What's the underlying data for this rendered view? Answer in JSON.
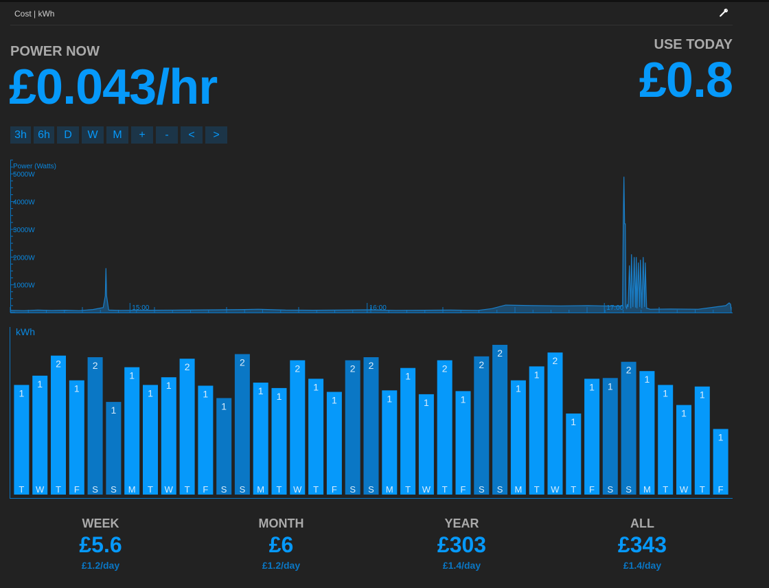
{
  "header": {
    "title": "Cost | kWh",
    "settings_icon": "wrench-icon"
  },
  "power_now": {
    "label": "POWER NOW",
    "value": "£0.043/hr"
  },
  "use_today": {
    "label": "USE TODAY",
    "value": "£0.8"
  },
  "range_buttons": [
    "3h",
    "6h",
    "D",
    "W",
    "M",
    "+",
    "-",
    "<",
    ">"
  ],
  "colors": {
    "background": "#222222",
    "accent": "#0699fa",
    "weekend_bar": "#0a77c5",
    "line": "#1a6dad",
    "button_bg": "#1c3548",
    "label_grey": "#aaaaaa"
  },
  "chart_data": [
    {
      "type": "area",
      "title": "",
      "ylabel": "Power (Watts)",
      "y_ticks": [
        "1000W",
        "2000W",
        "3000W",
        "4000W",
        "5000W"
      ],
      "ylim": [
        0,
        5500
      ],
      "x_ticks": [
        "15:00",
        "16:00",
        "17:00"
      ],
      "series": [
        {
          "x": [
            0,
            20,
            40,
            60,
            80,
            100,
            120,
            135,
            138,
            139,
            140,
            143,
            160,
            200,
            250,
            300,
            340,
            360,
            400,
            440,
            480,
            520,
            560,
            600,
            640,
            680,
            700,
            720,
            760,
            800,
            840,
            880,
            890,
            891,
            892,
            893,
            894,
            895,
            896,
            897,
            898,
            900,
            902,
            903,
            905,
            907,
            909,
            910,
            911,
            913,
            915,
            916,
            918,
            920,
            922,
            923,
            925,
            926,
            930,
            960,
            1000,
            1040,
            1045,
            1047,
            1048
          ],
          "y": [
            80,
            70,
            90,
            75,
            85,
            70,
            110,
            180,
            600,
            1600,
            600,
            90,
            80,
            85,
            90,
            100,
            110,
            120,
            90,
            85,
            90,
            100,
            80,
            85,
            90,
            80,
            140,
            270,
            250,
            240,
            250,
            230,
            240,
            3200,
            4900,
            3200,
            3200,
            200,
            150,
            300,
            200,
            1700,
            150,
            2100,
            200,
            2000,
            180,
            2000,
            150,
            1800,
            200,
            1900,
            150,
            2000,
            200,
            1800,
            150,
            150,
            120,
            130,
            120,
            250,
            350,
            300,
            100
          ]
        }
      ]
    },
    {
      "type": "bar",
      "title": "",
      "ylabel": "kWh",
      "categories": [
        "T",
        "W",
        "T",
        "F",
        "S",
        "S",
        "M",
        "T",
        "W",
        "T",
        "F",
        "S",
        "S",
        "M",
        "T",
        "W",
        "T",
        "F",
        "S",
        "S",
        "M",
        "T",
        "W",
        "T",
        "F",
        "S",
        "S",
        "M",
        "T",
        "W",
        "T",
        "F",
        "S",
        "S",
        "M",
        "T",
        "W",
        "T",
        "F"
      ],
      "weekend": [
        false,
        false,
        false,
        false,
        true,
        true,
        false,
        false,
        false,
        false,
        false,
        true,
        true,
        false,
        false,
        false,
        false,
        false,
        true,
        true,
        false,
        false,
        false,
        false,
        false,
        true,
        true,
        false,
        false,
        false,
        false,
        false,
        true,
        true,
        false,
        false,
        false,
        false,
        false
      ],
      "values": [
        1.42,
        1.54,
        1.8,
        1.48,
        1.78,
        1.2,
        1.65,
        1.42,
        1.52,
        1.76,
        1.41,
        1.25,
        1.82,
        1.45,
        1.38,
        1.74,
        1.5,
        1.33,
        1.74,
        1.78,
        1.35,
        1.64,
        1.3,
        1.74,
        1.34,
        1.79,
        1.94,
        1.48,
        1.66,
        1.84,
        1.05,
        1.5,
        1.51,
        1.72,
        1.6,
        1.42,
        1.16,
        1.4,
        0.85
      ],
      "data_labels": [
        "1",
        "1",
        "2",
        "1",
        "2",
        "1",
        "1",
        "1",
        "1",
        "2",
        "1",
        "1",
        "2",
        "1",
        "1",
        "2",
        "1",
        "1",
        "2",
        "2",
        "1",
        "1",
        "1",
        "2",
        "1",
        "2",
        "2",
        "1",
        "1",
        "2",
        "1",
        "1",
        "1",
        "2",
        "1",
        "1",
        "1",
        "1",
        "1"
      ],
      "ylim": [
        0,
        2.1
      ]
    }
  ],
  "summary": [
    {
      "label": "WEEK",
      "value": "£5.6",
      "rate": "£1.2/day"
    },
    {
      "label": "MONTH",
      "value": "£6",
      "rate": "£1.2/day"
    },
    {
      "label": "YEAR",
      "value": "£303",
      "rate": "£1.4/day"
    },
    {
      "label": "ALL",
      "value": "£343",
      "rate": "£1.4/day"
    }
  ]
}
